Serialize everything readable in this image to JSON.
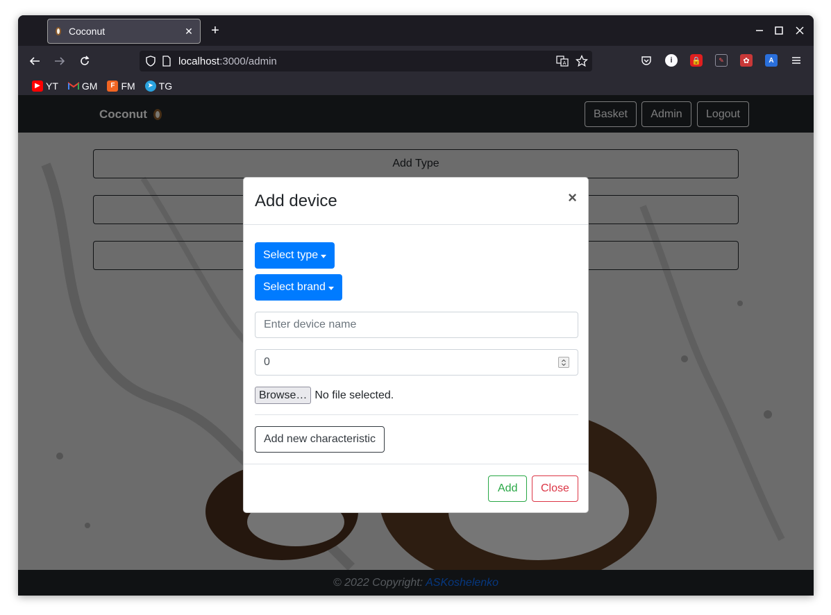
{
  "browser": {
    "tab_title": "Coconut",
    "url_host": "localhost",
    "url_rest": ":3000/admin",
    "bookmarks": [
      {
        "label": "YT",
        "icon": "youtube-icon",
        "color": "#ff0000"
      },
      {
        "label": "GM",
        "icon": "gmail-icon",
        "color": "#ea4335"
      },
      {
        "label": "FM",
        "icon": "fm-icon",
        "color": "#f26522",
        "letter": "F"
      },
      {
        "label": "TG",
        "icon": "telegram-icon",
        "color": "#2aa3df"
      }
    ]
  },
  "app": {
    "brand": "Coconut",
    "nav": {
      "basket": "Basket",
      "admin": "Admin",
      "logout": "Logout"
    },
    "admin_buttons": [
      "Add Type",
      "",
      ""
    ],
    "footer": {
      "text": "© 2022 Copyright:",
      "link": "ASKoshelenko"
    }
  },
  "modal": {
    "title": "Add device",
    "close_x": "×",
    "select_type": "Select type",
    "select_brand": "Select brand",
    "name_placeholder": "Enter device name",
    "price_value": "0",
    "browse_label": "Browse…",
    "file_status": "No file selected.",
    "add_characteristic": "Add new characteristic",
    "add_label": "Add",
    "close_label": "Close"
  },
  "colors": {
    "primary": "#007bff",
    "success": "#28a745",
    "danger": "#dc3545",
    "navbar": "#212529",
    "link": "#0d6efd"
  }
}
